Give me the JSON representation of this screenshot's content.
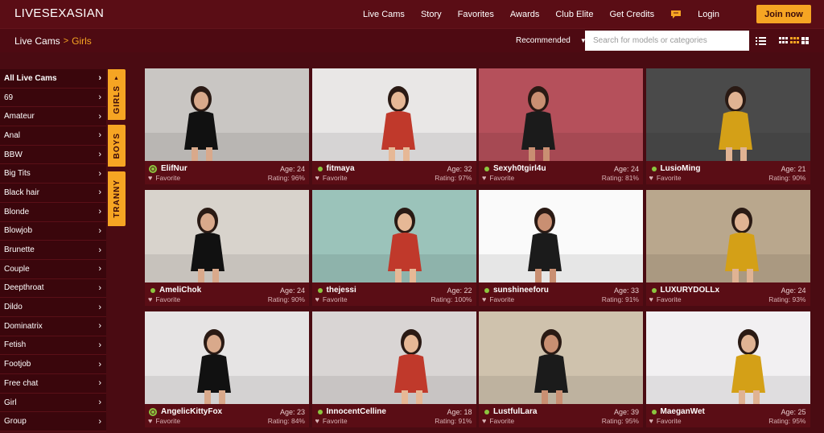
{
  "header": {
    "logo": "LIVESEXASIAN",
    "nav": [
      "Live Cams",
      "Story",
      "Favorites",
      "Awards",
      "Club Elite",
      "Get Credits"
    ],
    "login": "Login",
    "join": "Join now"
  },
  "subbar": {
    "crumb_root": "Live Cams",
    "crumb_sep": ">",
    "crumb_current": "Girls",
    "sort_label": "Recommended",
    "search_placeholder": "Search for models or categories"
  },
  "sidebar": {
    "items": [
      "All Live Cams",
      "69",
      "Amateur",
      "Anal",
      "BBW",
      "Big Tits",
      "Black hair",
      "Blonde",
      "Blowjob",
      "Brunette",
      "Couple",
      "Deepthroat",
      "Dildo",
      "Dominatrix",
      "Fetish",
      "Footjob",
      "Free chat",
      "Girl",
      "Group"
    ]
  },
  "tabs": {
    "girls": "GIRLS",
    "boys": "BOYS",
    "tranny": "TRANNY"
  },
  "card_labels": {
    "favorite": "Favorite",
    "age_prefix": "Age:",
    "rating_prefix": "Rating:"
  },
  "models": [
    {
      "name": "ElifNur",
      "age": "Age: 24",
      "rating": "Rating: 96%",
      "ring": true,
      "bg": "#c9c6c3"
    },
    {
      "name": "fitmaya",
      "age": "Age: 32",
      "rating": "Rating: 97%",
      "ring": false,
      "bg": "#e9e7e6"
    },
    {
      "name": "Sexyh0tgirl4u",
      "age": "Age: 24",
      "rating": "Rating: 81%",
      "ring": false,
      "bg": "#b5505b"
    },
    {
      "name": "LusioMing",
      "age": "Age: 21",
      "rating": "Rating: 90%",
      "ring": false,
      "bg": "#4a4a4a"
    },
    {
      "name": "AmeliChok",
      "age": "Age: 24",
      "rating": "Rating: 90%",
      "ring": false,
      "bg": "#d8d3cc"
    },
    {
      "name": "thejessi",
      "age": "Age: 22",
      "rating": "Rating: 100%",
      "ring": false,
      "bg": "#9bc3ba"
    },
    {
      "name": "sunshineeforu",
      "age": "Age: 33",
      "rating": "Rating: 91%",
      "ring": false,
      "bg": "#fafafa"
    },
    {
      "name": "LUXURYDOLLx",
      "age": "Age: 24",
      "rating": "Rating: 93%",
      "ring": false,
      "bg": "#b9a78d"
    },
    {
      "name": "AngelicKittyFox",
      "age": "Age: 23",
      "rating": "Rating: 84%",
      "ring": true,
      "bg": "#e6e4e4"
    },
    {
      "name": "InnocentCelline",
      "age": "Age: 18",
      "rating": "Rating: 91%",
      "ring": false,
      "bg": "#d9d5d4"
    },
    {
      "name": "LustfulLara",
      "age": "Age: 39",
      "rating": "Rating: 95%",
      "ring": false,
      "bg": "#cfc2ad"
    },
    {
      "name": "MaeganWet",
      "age": "Age: 25",
      "rating": "Rating: 95%",
      "ring": false,
      "bg": "#f2f0f2"
    }
  ]
}
